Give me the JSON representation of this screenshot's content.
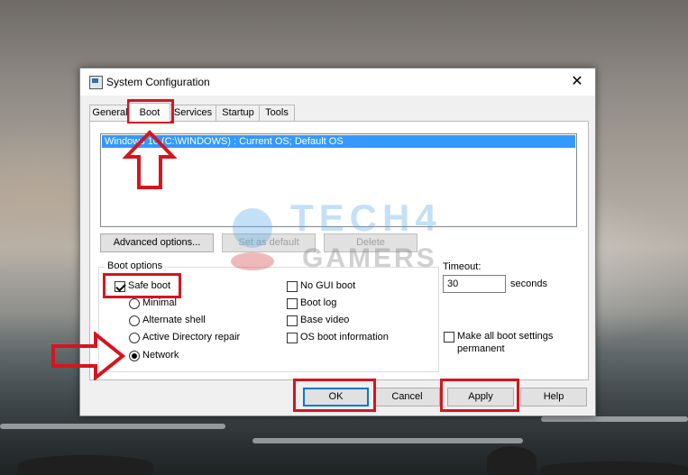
{
  "window": {
    "title": "System Configuration",
    "close_label": "✕"
  },
  "tabs": [
    {
      "label": "General",
      "active": false
    },
    {
      "label": "Boot",
      "active": true
    },
    {
      "label": "Services",
      "active": false
    },
    {
      "label": "Startup",
      "active": false
    },
    {
      "label": "Tools",
      "active": false
    }
  ],
  "os_list": {
    "selected_entry": "Windows 10 (C:\\WINDOWS) : Current OS; Default OS"
  },
  "buttons": {
    "advanced": "Advanced options...",
    "set_default": "Set as default",
    "delete": "Delete",
    "ok": "OK",
    "cancel": "Cancel",
    "apply": "Apply",
    "help": "Help"
  },
  "boot_options": {
    "group_label": "Boot options",
    "safe_boot": {
      "label": "Safe boot",
      "checked": true
    },
    "radios": [
      {
        "label": "Minimal",
        "checked": false
      },
      {
        "label": "Alternate shell",
        "checked": false
      },
      {
        "label": "Active Directory repair",
        "checked": false
      },
      {
        "label": "Network",
        "checked": true
      }
    ],
    "checks": [
      {
        "label": "No GUI boot",
        "checked": false
      },
      {
        "label": "Boot log",
        "checked": false
      },
      {
        "label": "Base video",
        "checked": false
      },
      {
        "label": "OS boot information",
        "checked": false
      }
    ]
  },
  "timeout": {
    "label": "Timeout:",
    "value": "30",
    "unit": "seconds"
  },
  "permanent": {
    "label_line1": "Make all boot settings",
    "label_line2": "permanent",
    "checked": false
  },
  "watermark": {
    "line1": "TECH4",
    "line2": "GAMERS"
  },
  "colors": {
    "annotation_red": "#d6151d",
    "selection_blue": "#3399ff"
  }
}
